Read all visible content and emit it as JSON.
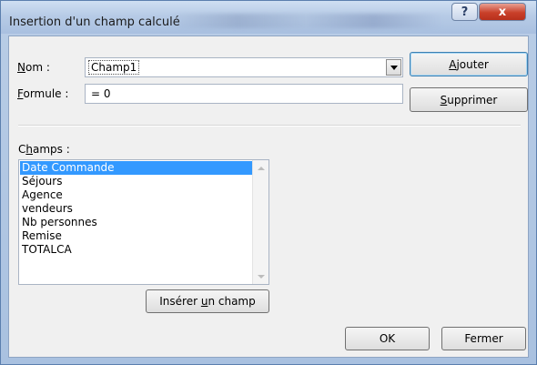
{
  "window": {
    "title": "Insertion d'un champ calculé",
    "help_glyph": "?",
    "close_glyph": "x"
  },
  "form": {
    "name_label_mnemonic": "N",
    "name_label_rest": "om :",
    "name_value": "Champ1",
    "formula_label_mnemonic": "F",
    "formula_label_rest": "ormule :",
    "formula_value": "= 0"
  },
  "buttons": {
    "add_before": "",
    "add_mnemonic": "A",
    "add_after": "jouter",
    "delete_mnemonic": "S",
    "delete_after": "upprimer",
    "insert_before": "Insérer ",
    "insert_mnemonic": "u",
    "insert_after": "n champ",
    "ok": "OK",
    "close": "Fermer"
  },
  "fields": {
    "label_before": "C",
    "label_mnemonic": "h",
    "label_after": "amps :",
    "items": [
      "Date Commande",
      "Séjours",
      "Agence",
      "vendeurs",
      "Nb personnes",
      "Remise",
      "TOTALCA"
    ],
    "selected_index": 0
  }
}
